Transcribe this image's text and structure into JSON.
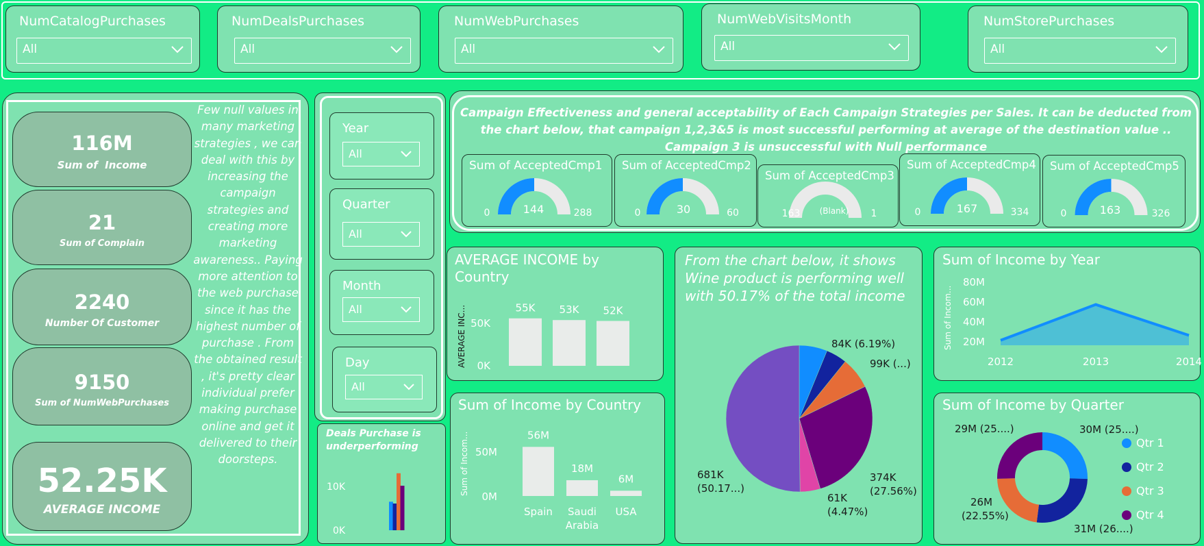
{
  "filters": [
    {
      "label": "NumCatalogPurchases",
      "value": "All"
    },
    {
      "label": "NumDealsPurchases",
      "value": "All"
    },
    {
      "label": "NumWebPurchases",
      "value": "All"
    },
    {
      "label": "NumWebVisitsMonth",
      "value": "All"
    },
    {
      "label": "NumStorePurchases",
      "value": "All"
    }
  ],
  "kpis": [
    {
      "value": "116M",
      "label": "Sum of  Income"
    },
    {
      "value": "21",
      "label": "Sum of Complain"
    },
    {
      "value": "2240",
      "label": "Number Of Customer"
    },
    {
      "value": "9150",
      "label": "Sum of NumWebPurchases"
    },
    {
      "value": "52.25K",
      "label": "AVERAGE INCOME"
    }
  ],
  "notes": {
    "marketing": "Few null values in many marketing strategies , we can deal with this by increasing the campaign strategies and creating more marketing awareness.. Paying more attention to the web purchase since it has the highest number of purchase . From the obtained result , it's pretty clear individual prefer making purchase online and get it delivered to their doorsteps.",
    "campaign": "Campaign Effectiveness and general acceptability of Each Campaign Strategies per Sales. It can be deducted from the chart below, that campaign 1,2,3&5 is most successful performing at average of the destination value .. Campaign 3 is unsuccessful with Null performance",
    "deals": "Deals Purchase is underperforming",
    "wine": "From the chart below, it shows Wine product is performing well with 50.17% of the total income"
  },
  "slicers": [
    {
      "label": "Year",
      "value": "All"
    },
    {
      "label": "Quarter",
      "value": "All"
    },
    {
      "label": "Month",
      "value": "All"
    },
    {
      "label": "Day",
      "value": "All"
    }
  ],
  "gauges": [
    {
      "title": "Sum of AcceptedCmp1",
      "min": "0",
      "value": "144",
      "max": "288",
      "fraction": 0.5
    },
    {
      "title": "Sum of AcceptedCmp2",
      "min": "0",
      "value": "30",
      "max": "60",
      "fraction": 0.5
    },
    {
      "title": "Sum of AcceptedCmp3",
      "min": "163",
      "value": "(Blank)",
      "max": "1",
      "fraction": 0
    },
    {
      "title": "Sum of AcceptedCmp4",
      "min": "0",
      "value": "167",
      "max": "334",
      "fraction": 0.5
    },
    {
      "title": "Sum of AcceptedCmp5",
      "min": "0",
      "value": "163",
      "max": "326",
      "fraction": 0.5
    }
  ],
  "colors": {
    "background": "#12ec85",
    "panel": "#7fe2b0",
    "kpi": "#8fc0a3",
    "bar": "#e9ecea",
    "gauge_fill": "#118dff",
    "gauge_track": "#eaeaea",
    "qtr1": "#118dff",
    "qtr2": "#12239e",
    "qtr3": "#e66c37",
    "qtr4": "#6b007b",
    "wine": "#744ec2",
    "area_fill": "#4ec0d5",
    "line": "#118dff"
  },
  "chart_data": [
    {
      "id": "avg_income_by_country",
      "type": "bar",
      "title": "AVERAGE INCOME by Country",
      "ylabel": "AVERAGE INC...",
      "ytick_labels": [
        "0K",
        "50K"
      ],
      "ylim": [
        0,
        60
      ],
      "values": [
        55,
        53,
        52
      ],
      "value_labels": [
        "55K",
        "53K",
        "52K"
      ]
    },
    {
      "id": "sum_income_by_country",
      "type": "bar",
      "title": "Sum of Income by Country",
      "ylabel": "Sum of Incom...",
      "ytick_labels": [
        "0M",
        "50M"
      ],
      "ylim": [
        0,
        60
      ],
      "categories": [
        "Spain",
        "Saudi Arabia",
        "USA"
      ],
      "values": [
        56,
        18,
        6
      ],
      "value_labels": [
        "56M",
        "18M",
        "6M"
      ]
    },
    {
      "id": "deals_purchase",
      "type": "bar",
      "ytick_labels": [
        "0K",
        "10K"
      ],
      "ylim": [
        0,
        14
      ],
      "series": [
        {
          "color": "#118dff",
          "value": 6.4
        },
        {
          "color": "#12239e",
          "value": 6.0
        },
        {
          "color": "#e66c37",
          "value": 12.8
        },
        {
          "color": "#6b007b",
          "value": 10.0
        }
      ]
    },
    {
      "id": "product_income_pie",
      "type": "pie",
      "slices": [
        {
          "label": "84K (6.19%)",
          "percent": 6.19,
          "color": "#118dff"
        },
        {
          "label": "",
          "percent": 4.62,
          "color": "#12239e"
        },
        {
          "label": "99K (...)",
          "percent": 6.99,
          "color": "#e66c37"
        },
        {
          "label": "374K (27.56%)",
          "percent": 27.56,
          "color": "#6b007b"
        },
        {
          "label": "61K (4.47%)",
          "percent": 4.47,
          "color": "#e044a7"
        },
        {
          "label": "681K (50.17...)",
          "percent": 50.17,
          "color": "#744ec2"
        }
      ]
    },
    {
      "id": "income_by_year",
      "type": "area",
      "title": "Sum of Income by Year",
      "ylabel": "Sum of Incom...",
      "ytick_labels": [
        "20M",
        "40M",
        "60M",
        "80M"
      ],
      "ylim": [
        20,
        80
      ],
      "x": [
        "2012",
        "2013",
        "2014"
      ],
      "values": [
        25,
        61,
        30
      ]
    },
    {
      "id": "income_by_quarter",
      "type": "pie",
      "donut": true,
      "title": "Sum of Income by Quarter",
      "legend": [
        "Qtr 1",
        "Qtr 2",
        "Qtr 3",
        "Qtr 4"
      ],
      "slices": [
        {
          "label": "30M (25....)",
          "percent": 25.5,
          "color": "#118dff"
        },
        {
          "label": "31M (26....)",
          "percent": 26.5,
          "color": "#12239e"
        },
        {
          "label": "26M (22.55%)",
          "percent": 22.55,
          "color": "#e66c37"
        },
        {
          "label": "29M (25....)",
          "percent": 25.45,
          "color": "#6b007b"
        }
      ]
    }
  ]
}
